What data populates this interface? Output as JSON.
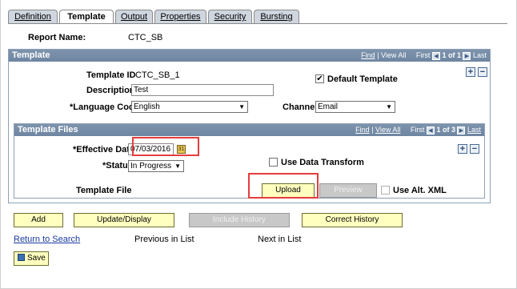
{
  "tabs": [
    {
      "label": "Definition"
    },
    {
      "label": "Template"
    },
    {
      "label": "Output"
    },
    {
      "label": "Properties"
    },
    {
      "label": "Security"
    },
    {
      "label": "Bursting"
    }
  ],
  "report": {
    "label": "Report Name:",
    "value": "CTC_SB"
  },
  "template_section": {
    "title": "Template",
    "nav": {
      "find": "Find",
      "view_all": "View All",
      "first": "First",
      "counter": "1 of 1",
      "last": "Last"
    },
    "template_id_label": "Template ID",
    "template_id_value": "CTC_SB_1",
    "description_label": "Description",
    "description_value": "Test",
    "language_label": "*Language Code",
    "language_value": "English",
    "default_template_label": "Default Template",
    "default_template_checked": true,
    "channel_label": "Channel",
    "channel_value": "Email"
  },
  "template_files": {
    "title": "Template Files",
    "nav": {
      "find": "Find",
      "view_all": "View All",
      "first": "First",
      "counter": "1 of 3",
      "last": "Last"
    },
    "effective_date_label": "*Effective Date",
    "effective_date_value": "07/03/2016",
    "status_label": "*Status",
    "status_value": "In Progress",
    "use_data_transform_label": "Use Data Transform",
    "template_file_label": "Template File",
    "upload_label": "Upload",
    "preview_label": "Preview",
    "use_alt_xml_label": "Use Alt. XML"
  },
  "buttons": {
    "add": "Add",
    "update_display": "Update/Display",
    "include_history": "Include History",
    "correct_history": "Correct History"
  },
  "footer": {
    "return_to_search": "Return to Search",
    "previous_in_list": "Previous in List",
    "next_in_list": "Next in List",
    "save": "Save"
  },
  "icons": {
    "calendar": "calendar-icon",
    "save": "save-icon",
    "add_row": "plus-icon",
    "delete_row": "minus-icon"
  },
  "colors": {
    "header_bar": "#7489a5",
    "button_yellow": "#ffffbf",
    "highlight_red": "#e53d3d"
  }
}
